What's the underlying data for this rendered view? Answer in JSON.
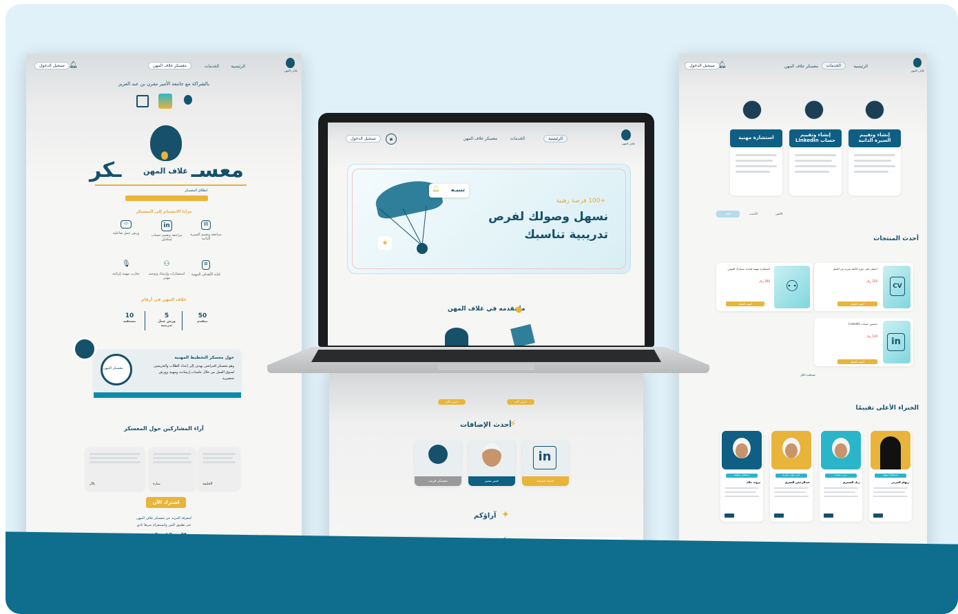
{
  "colors": {
    "navy": "#0e5f83",
    "gold": "#e9b43a",
    "bg": "#e0f1f9",
    "dark_teal": "#0f6d8d"
  },
  "left_page": {
    "nav": {
      "home": "الرئيسية",
      "services": "الخدمات",
      "camp": "معسكر غلاف المهن",
      "login": "تسجيل الدخول"
    },
    "partnership": "بالشراكة مع جامعة الأمير مقرن بن عبد العزيز",
    "brand_small": "غلاف المهن",
    "hero_title_1": "معسـ",
    "hero_title_2": "ـكر",
    "hero_brand": "غلاف المهن",
    "hero_sub": "انطلاق المعسكر",
    "benefits_title": "مزايا الانضمام إلى المعسكر",
    "features": [
      {
        "label": "مراجعة وتقييم السيرة الذاتية",
        "icon": "cv-icon"
      },
      {
        "label": "مراجعة وتقييم حساب لينكدإن",
        "icon": "linkedin-icon"
      },
      {
        "label": "ورش عمل تفاعلية",
        "icon": "workshop-icon"
      },
      {
        "label": "كتابة الأهداف المهنية",
        "icon": "goals-icon"
      },
      {
        "label": "استشارات وإرشاد وتوجيه مهني",
        "icon": "mentoring-icon"
      },
      {
        "label": "تجارب مهنية إثرائية",
        "icon": "mic-icon"
      }
    ],
    "numbers_title": "غلاف المهن في أرقام",
    "stats": [
      {
        "value": "50",
        "label": "متقدم"
      },
      {
        "value": "5",
        "label": "ورش عمل تدريبية"
      },
      {
        "value": "10",
        "label": "مستفيد"
      }
    ],
    "about_title": "حول معسكر التخطيط المهنية",
    "about_text": "وهو معسكر افتراضي يهدف إلى إعداد الطلاب والخريجين لسوق العمل من خلال جلسات إرشادية ومهنية وورش تحضيرية",
    "stamp_text": "معسكر المهن",
    "testimonials_title": "آراء المشاركين حول المعسكر",
    "testimonial_names": [
      "بلال",
      "سارة",
      "الخليفة"
    ],
    "cta": "اشترك الآن",
    "footer_line1": "لمعرفة المزيد عن معسكر غلاف المهن",
    "footer_line2": "عبر تطبيق اكس وانستقرام سرها نادي",
    "footer_tag": "#المهن_الطفرة_المستمرة"
  },
  "laptop_page": {
    "nav": {
      "home": "الرئيسية",
      "services": "الخدمات",
      "camp": "معسكر غلاف المهن",
      "login": "تسجيل الدخول"
    },
    "brand_small": "غلاف المهن",
    "hero_tag": "+100 فرصة رهيبة",
    "hero_title_1": "نسهل وصولك لفرص",
    "hero_title_2": "تدريبية تناسبك",
    "alert_chip": "تنبيـه",
    "offer_title": "ما نقدمه في غلاف المهن",
    "offer_buttons": [
      "اعرف أكثر",
      "اعرف أكثر"
    ],
    "latest_title": "أحدث الإضافات",
    "latest_cards": [
      {
        "label": "خدمة جديدة"
      },
      {
        "label": "خبير مميز"
      },
      {
        "label": "معسكر قريب"
      }
    ],
    "opinions_title": "آراؤكم"
  },
  "right_page": {
    "nav": {
      "home": "الرئيسية",
      "services": "الخدمات",
      "camp": "معسكر غلاف المهن",
      "login": "تسجيل الدخول"
    },
    "brand_small": "غلاف المهن",
    "services": [
      {
        "title": "إنشاء وتقييم السيرة الذاتية"
      },
      {
        "title": "إنشاء وتقييم حساب LinkedIn"
      },
      {
        "title": "استشارة مهنية"
      }
    ],
    "filter_tabs": [
      "الكل",
      "الأحدث",
      "الأعلى"
    ],
    "products_title": "أحدث المنتجات",
    "products": [
      {
        "name": "احصل على دورة كاملة بمزيد من العمل",
        "price": "150 ريال",
        "button": "أضف للسلة"
      },
      {
        "name": "استشارة مهنية لتحديد مسارك المهني",
        "price": "200 ريال",
        "button": "أضف للسلة"
      },
      {
        "name": "تحسين حساب LinkedIn",
        "price": "120 ريال",
        "button": "أضف للسلة"
      }
    ],
    "more_link": "مشاهدة الكل",
    "experts_title": "الخبراء الأعلى تقييمًا",
    "experts": [
      {
        "name": "ريهام الحربي",
        "role": "مستشارة مهنية",
        "frame": "#e9b43a"
      },
      {
        "name": "زياد الشمري",
        "role": "مدرب معتمد",
        "frame": "#2bb5c9"
      },
      {
        "name": "عبدالرحمن العمري",
        "role": "خبير موارد بشرية",
        "frame": "#e9b43a"
      },
      {
        "name": "ثروت خالد",
        "role": "مستشار توظيف",
        "frame": "#0e5f83"
      }
    ]
  }
}
